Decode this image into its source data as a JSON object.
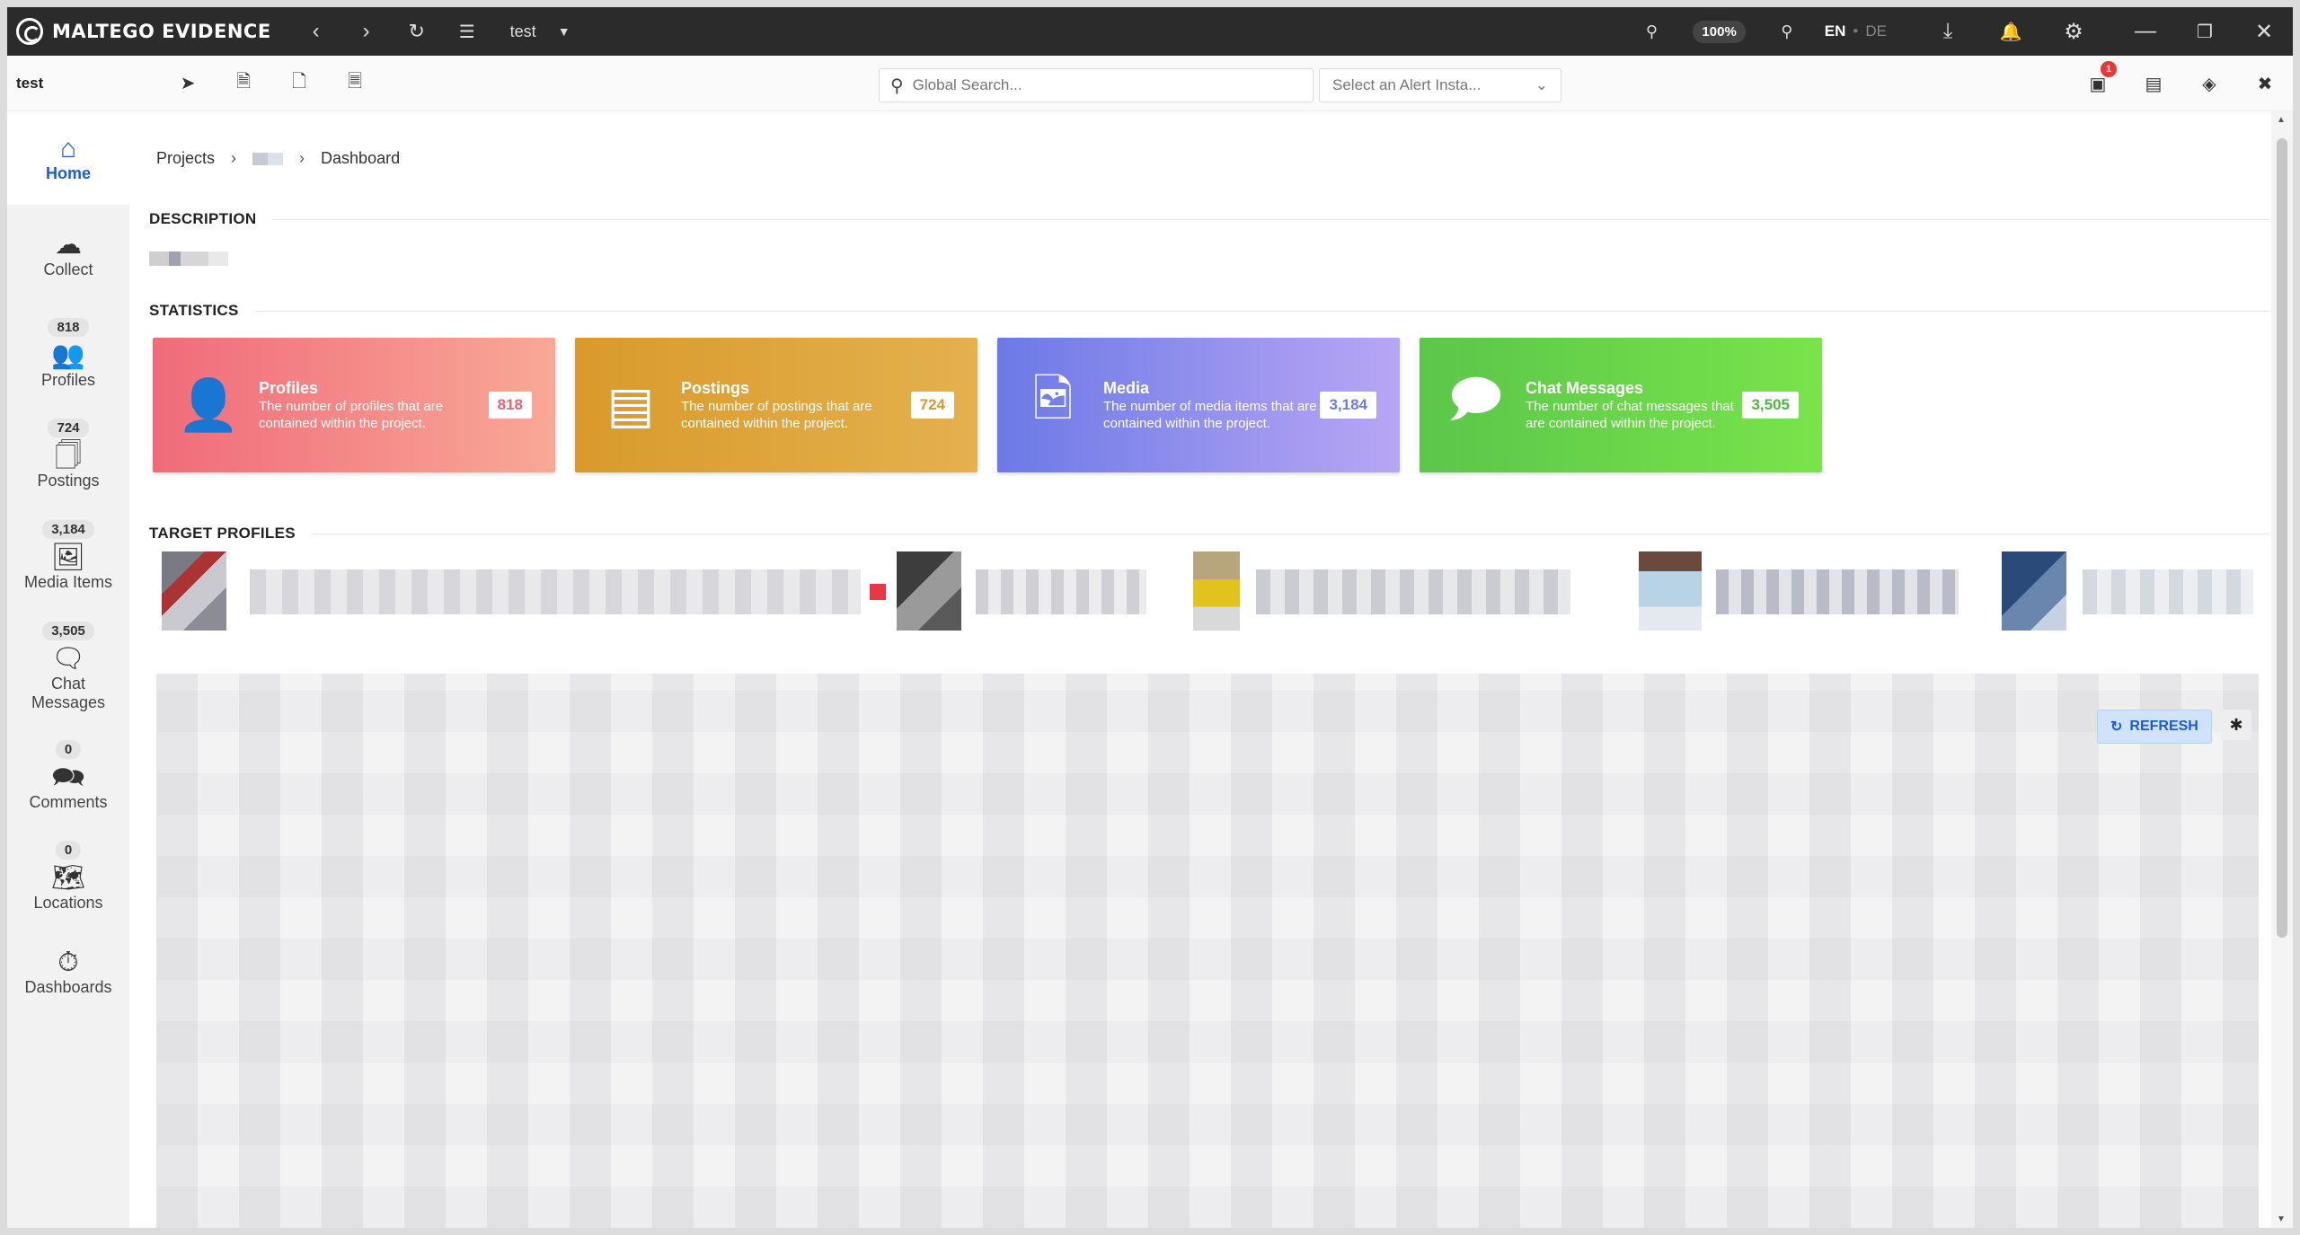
{
  "app": {
    "brand_prefix": "MALTEGO",
    "brand_suffix": "EVIDENCE",
    "project_dropdown": "test",
    "zoom": "100%",
    "lang_active": "EN",
    "lang_inactive": "DE",
    "notification_count": "1"
  },
  "toolbar": {
    "project_label": "test",
    "search_placeholder": "Global Search...",
    "alert_placeholder": "Select an Alert Insta..."
  },
  "sidebar": {
    "items": [
      {
        "label": "Home",
        "icon": "home-icon",
        "count": ""
      },
      {
        "label": "Collect",
        "icon": "cloud-download-icon",
        "count": ""
      },
      {
        "label": "Profiles",
        "icon": "users-icon",
        "count": "818"
      },
      {
        "label": "Postings",
        "icon": "document-icon",
        "count": "724"
      },
      {
        "label": "Media Items",
        "icon": "images-icon",
        "count": "3,184"
      },
      {
        "label": "Chat Messages",
        "icon": "chat-icon",
        "count": "3,505"
      },
      {
        "label": "Comments",
        "icon": "comments-icon",
        "count": "0"
      },
      {
        "label": "Locations",
        "icon": "map-pin-icon",
        "count": "0"
      },
      {
        "label": "Dashboards",
        "icon": "gauge-icon",
        "count": ""
      }
    ]
  },
  "breadcrumb": {
    "root": "Projects",
    "current": "Dashboard"
  },
  "sections": {
    "description": "DESCRIPTION",
    "statistics": "STATISTICS",
    "target_profiles": "TARGET PROFILES"
  },
  "stats": [
    {
      "title": "Profiles",
      "desc": "The number of profiles that are contained within the project.",
      "value": "818",
      "color": "#f06b7a"
    },
    {
      "title": "Postings",
      "desc": "The number of postings that are contained within the project.",
      "value": "724",
      "color": "#d99a2b"
    },
    {
      "title": "Media",
      "desc": "The number of media items that are contained within the project.",
      "value": "3,184",
      "color": "#6c79e6"
    },
    {
      "title": "Chat Messages",
      "desc": "The number of chat messages that are contained within the project.",
      "value": "3,505",
      "color": "#5bc64a"
    }
  ],
  "panel": {
    "refresh_label": "REFRESH"
  }
}
